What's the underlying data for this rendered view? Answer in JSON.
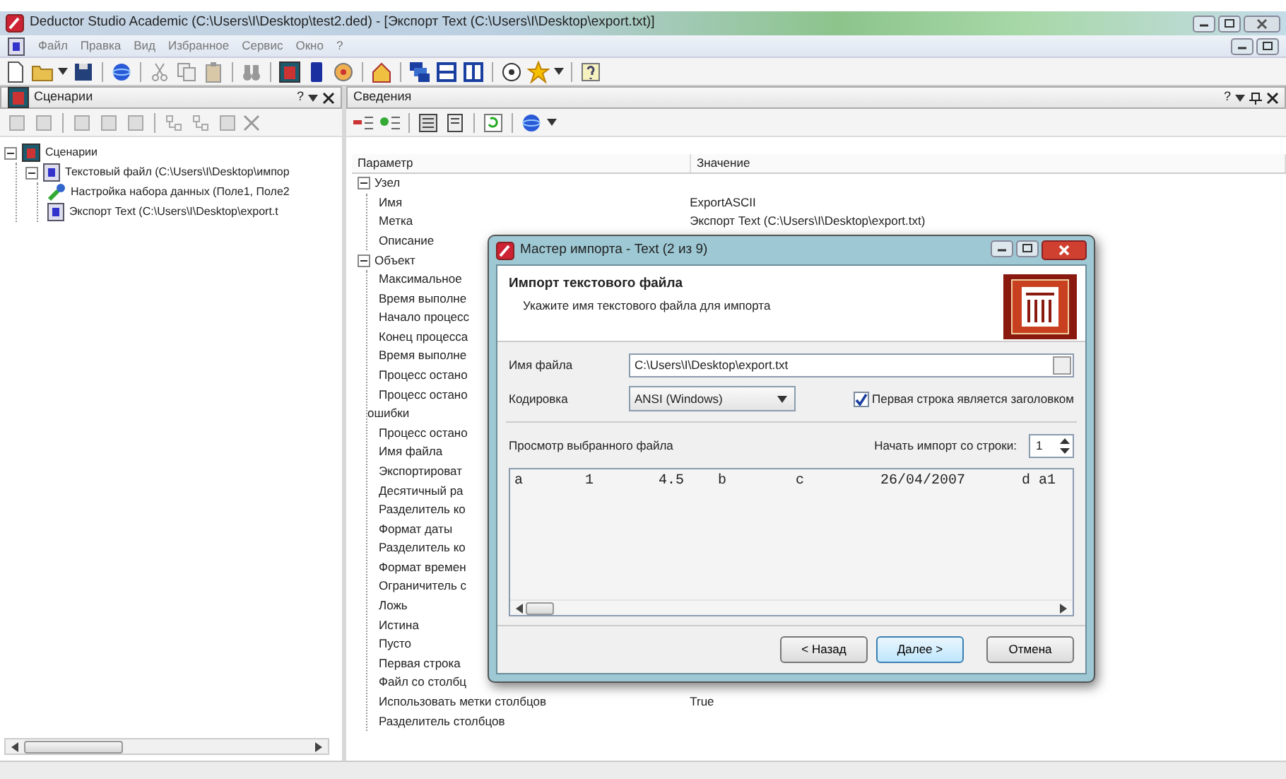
{
  "window": {
    "title": "Deductor Studio Academic (C:\\Users\\I\\Desktop\\test2.ded) - [Экспорт Text (C:\\Users\\I\\Desktop\\export.txt)]"
  },
  "menu": [
    "Файл",
    "Правка",
    "Вид",
    "Избранное",
    "Сервис",
    "Окно",
    "?"
  ],
  "left_panel": {
    "title": "Сценарии",
    "help": "?",
    "tree": [
      {
        "label": "Сценарии",
        "expanded": true,
        "children": [
          {
            "label": "Текстовый файл (C:\\Users\\I\\Desktop\\импор",
            "expanded": true,
            "children": [
              {
                "label": "Настройка набора данных (Поле1, Поле2"
              },
              {
                "label": "Экспорт Text (C:\\Users\\I\\Desktop\\export.t"
              }
            ]
          }
        ]
      }
    ]
  },
  "right_panel": {
    "title": "Сведения",
    "help": "?",
    "table": {
      "columns": [
        "Параметр",
        "Значение"
      ],
      "sections": [
        {
          "label": "Узел",
          "expanded": true,
          "rows": [
            {
              "name": "Имя",
              "value": "ExportASCII"
            },
            {
              "name": "Метка",
              "value": "Экспорт Text (C:\\Users\\I\\Desktop\\export.txt)"
            },
            {
              "name": "Описание"
            }
          ]
        },
        {
          "label": "Объект",
          "expanded": true,
          "rows": [
            {
              "name": "Максимальное"
            },
            {
              "name": "Время выполне"
            },
            {
              "name": "Начало процесс"
            },
            {
              "name": "Конец процесса"
            },
            {
              "name": "Время выполне"
            },
            {
              "name": "Процесс остано"
            },
            {
              "name": "Процесс остано\nошибки"
            },
            {
              "name": "Процесс остано"
            },
            {
              "name": "Имя файла"
            },
            {
              "name": "Экспортироват"
            },
            {
              "name": "Десятичный ра"
            },
            {
              "name": "Разделитель ко"
            },
            {
              "name": "Формат даты"
            },
            {
              "name": "Разделитель ко"
            },
            {
              "name": "Формат времен"
            },
            {
              "name": "Ограничитель с"
            },
            {
              "name": "Ложь"
            },
            {
              "name": "Истина"
            },
            {
              "name": "Пусто"
            },
            {
              "name": "Первая строка"
            },
            {
              "name": "Файл со столбц"
            },
            {
              "name": "Использовать метки столбцов",
              "value": "True"
            },
            {
              "name": "Разделитель столбцов"
            }
          ]
        }
      ]
    }
  },
  "dialog": {
    "title": "Мастер импорта - Text (2 из 9)",
    "heading": "Импорт текстового файла",
    "subheading": "Укажите имя текстового файла для импорта",
    "file_label": "Имя файла",
    "file_value": "C:\\Users\\I\\Desktop\\export.txt",
    "encoding_label": "Кодировка",
    "encoding_value": "ANSI (Windows)",
    "header_checkbox": {
      "label": "Первая строка является заголовком",
      "checked": true
    },
    "preview_label": "Просмотр выбранного файла",
    "start_label": "Начать импорт со строки:",
    "start_value": "1",
    "preview_rows": [
      [
        "a",
        "1",
        "4.5",
        "b",
        "c",
        "26/04/2007",
        "d a1"
      ]
    ],
    "buttons": [
      {
        "label": "< Назад",
        "default": false
      },
      {
        "label": "Далее >",
        "default": true
      },
      {
        "label": "Отмена",
        "default": false
      }
    ]
  }
}
